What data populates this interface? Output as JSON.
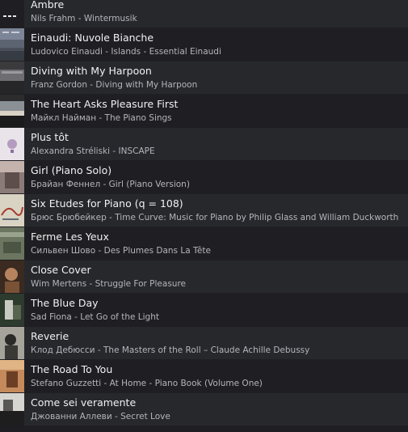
{
  "tracks": [
    {
      "title": "Ambre",
      "subtitle": "Nils Frahm - Wintermusik",
      "art_icon": "wintermusik-cover"
    },
    {
      "title": "Einaudi: Nuvole Bianche",
      "subtitle": "Ludovico Einaudi - Islands - Essential Einaudi",
      "art_icon": "islands-cover"
    },
    {
      "title": "Diving with My Harpoon",
      "subtitle": "Franz Gordon - Diving with My Harpoon",
      "art_icon": "diving-harpoon-cover"
    },
    {
      "title": "The Heart Asks Pleasure First",
      "subtitle": "Майкл Найман - The Piano Sings",
      "art_icon": "piano-sings-cover"
    },
    {
      "title": "Plus tôt",
      "subtitle": "Alexandra Stréliski - INSCAPE",
      "art_icon": "inscape-cover"
    },
    {
      "title": "Girl (Piano Solo)",
      "subtitle": "Брайан Феннел - Girl (Piano Version)",
      "art_icon": "girl-piano-cover"
    },
    {
      "title": "Six Etudes for Piano (q = 108)",
      "subtitle": "Брюс Брюбейкер - Time Curve: Music for Piano by Philip Glass and William Duckworth",
      "art_icon": "time-curve-cover"
    },
    {
      "title": "Ferme Les Yeux",
      "subtitle": "Сильвен Шово - Des Plumes Dans La Tête",
      "art_icon": "des-plumes-cover"
    },
    {
      "title": "Close Cover",
      "subtitle": "Wim Mertens - Struggle For Pleasure",
      "art_icon": "struggle-pleasure-cover"
    },
    {
      "title": "The Blue Day",
      "subtitle": "Sad Fiona - Let Go of the Light",
      "art_icon": "let-go-light-cover"
    },
    {
      "title": "Reverie",
      "subtitle": "Клод Дебюсси - The Masters of the Roll – Claude Achille Debussy",
      "art_icon": "masters-roll-cover"
    },
    {
      "title": "The Road To You",
      "subtitle": "Stefano Guzzetti - At Home - Piano Book (Volume One)",
      "art_icon": "at-home-cover"
    },
    {
      "title": "Come sei veramente",
      "subtitle": "Джованни Аллеви - Secret Love",
      "art_icon": "secret-love-cover"
    }
  ]
}
